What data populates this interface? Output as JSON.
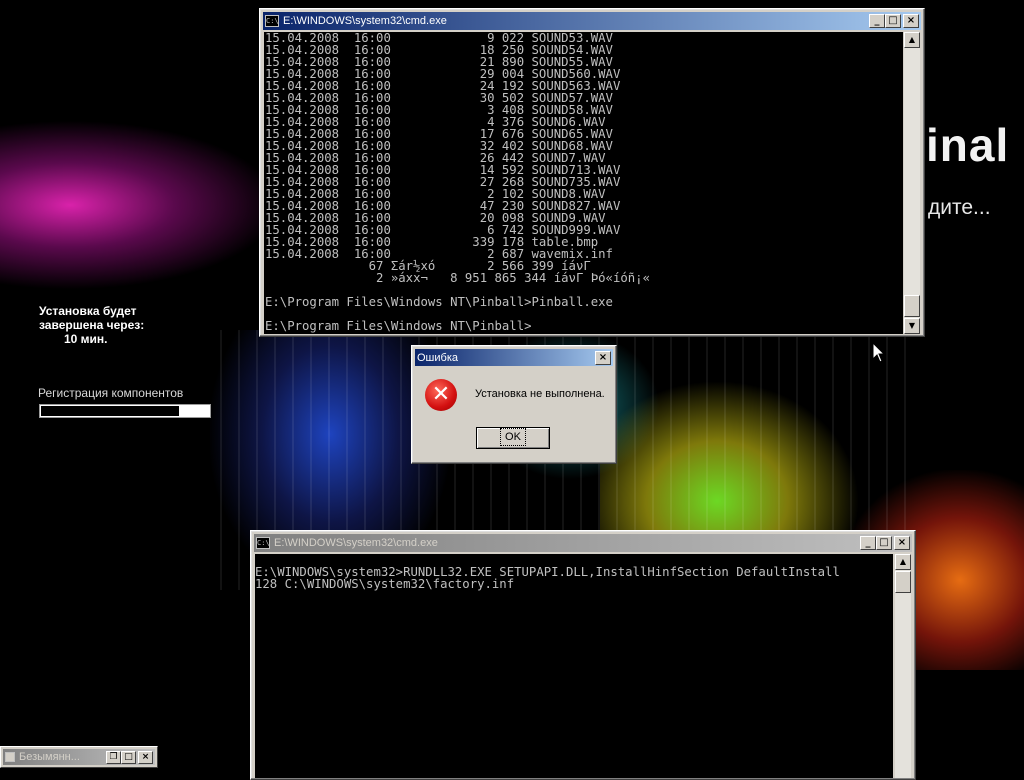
{
  "desktop": {
    "brand_text": "inal",
    "brand_subtext": "дите...",
    "setup_status": {
      "line1": "Установка будет",
      "line2": "завершена через:",
      "time": "10 мин."
    },
    "registration_label": "Регистрация компонентов",
    "registration_progress": 0.82
  },
  "cmd_top": {
    "title": "E:\\WINDOWS\\system32\\cmd.exe",
    "icon_label": "C:\\",
    "lines": [
      "15.04.2008  16:00             9 022 SOUND53.WAV",
      "15.04.2008  16:00            18 250 SOUND54.WAV",
      "15.04.2008  16:00            21 890 SOUND55.WAV",
      "15.04.2008  16:00            29 004 SOUND560.WAV",
      "15.04.2008  16:00            24 192 SOUND563.WAV",
      "15.04.2008  16:00            30 502 SOUND57.WAV",
      "15.04.2008  16:00             3 408 SOUND58.WAV",
      "15.04.2008  16:00             4 376 SOUND6.WAV",
      "15.04.2008  16:00            17 676 SOUND65.WAV",
      "15.04.2008  16:00            32 402 SOUND68.WAV",
      "15.04.2008  16:00            26 442 SOUND7.WAV",
      "15.04.2008  16:00            14 592 SOUND713.WAV",
      "15.04.2008  16:00            27 268 SOUND735.WAV",
      "15.04.2008  16:00             2 102 SOUND8.WAV",
      "15.04.2008  16:00            47 230 SOUND827.WAV",
      "15.04.2008  16:00            20 098 SOUND9.WAV",
      "15.04.2008  16:00             6 742 SOUND999.WAV",
      "15.04.2008  16:00           339 178 table.bmp",
      "15.04.2008  16:00             2 687 wavemix.inf",
      "              67 Σár½xó       2 566 399 íáνΓ",
      "               2 »áxx¬   8 951 865 344 íáνΓ Þó«íóñ¡«",
      "",
      "E:\\Program Files\\Windows NT\\Pinball>Pinball.exe",
      "",
      "E:\\Program Files\\Windows NT\\Pinball>"
    ]
  },
  "error_dialog": {
    "title": "Ошибка",
    "message": "Установка не выполнена.",
    "ok_label": "OK"
  },
  "cmd_bottom": {
    "title": "E:\\WINDOWS\\system32\\cmd.exe",
    "icon_label": "C:\\",
    "lines": [
      "",
      "E:\\WINDOWS\\system32>RUNDLL32.EXE SETUPAPI.DLL,InstallHinfSection DefaultInstall",
      "128 C:\\WINDOWS\\system32\\factory.inf"
    ]
  },
  "taskbar_window": {
    "title": "Безымянн..."
  },
  "window_buttons": {
    "minimize": "_",
    "maximize": "□",
    "restore": "❐",
    "close": "×"
  },
  "colors": {
    "titlebar_active": "#0a246a",
    "titlebar_inactive": "#808080",
    "console_bg": "#000000",
    "console_text": "#c0c0c0",
    "error_icon": "#d31010"
  }
}
